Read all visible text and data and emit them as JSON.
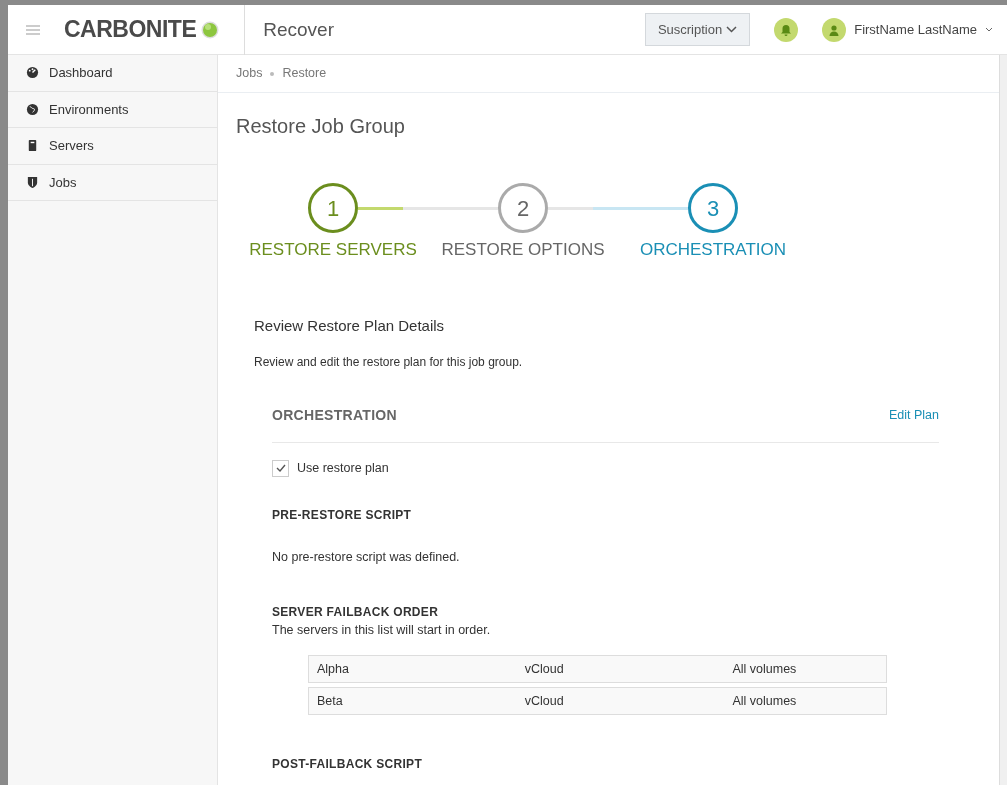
{
  "header": {
    "logo_text": "CARBONITE",
    "product": "Recover",
    "subscription_button": "Suscription",
    "user_name": "FirstName LastName"
  },
  "sidebar": {
    "items": [
      {
        "label": "Dashboard",
        "selected": false
      },
      {
        "label": "Environments",
        "selected": false
      },
      {
        "label": "Servers",
        "selected": false
      },
      {
        "label": "Jobs",
        "selected": false
      }
    ]
  },
  "breadcrumb": [
    "Jobs",
    "Restore"
  ],
  "page_title": "Restore Job Group",
  "steps": [
    {
      "number": "1",
      "label": "RESTORE SERVERS",
      "completed": true,
      "selected": false
    },
    {
      "number": "2",
      "label": "RESTORE OPTIONS",
      "completed": false,
      "selected": false
    },
    {
      "number": "3",
      "label": "ORCHESTRATION",
      "completed": false,
      "selected": true
    }
  ],
  "review": {
    "title": "Review Restore Plan Details",
    "description": "Review and edit the restore plan for this job group."
  },
  "orchestration": {
    "title": "ORCHESTRATION",
    "edit_link": "Edit Plan",
    "use_restore_plan": {
      "label": "Use restore plan",
      "checked": true
    },
    "pre_restore": {
      "title": "PRE-RESTORE SCRIPT",
      "text": "No pre-restore script was defined."
    },
    "failback": {
      "title": "SERVER FAILBACK ORDER",
      "description": "The servers in this list will start in order.",
      "rows": [
        {
          "name": "Alpha",
          "platform": "vCloud",
          "volumes": "All volumes"
        },
        {
          "name": "Beta",
          "platform": "vCloud",
          "volumes": "All volumes"
        }
      ]
    },
    "post_failback": {
      "title": "POST-FAILBACK SCRIPT"
    }
  }
}
